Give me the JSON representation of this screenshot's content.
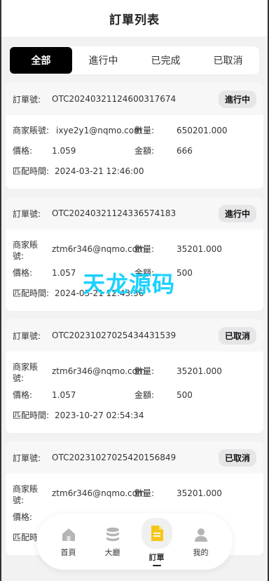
{
  "header": {
    "title": "訂單列表"
  },
  "tabs": [
    {
      "label": "全部",
      "active": true
    },
    {
      "label": "進行中",
      "active": false
    },
    {
      "label": "已完成",
      "active": false
    },
    {
      "label": "已取消",
      "active": false
    }
  ],
  "labels": {
    "order_no": "訂單號:",
    "merchant": "商家賬號:",
    "merchant_wrap_1": "商家賬",
    "merchant_wrap_2": "號:",
    "price": "價格:",
    "quantity": "數量:",
    "amount": "金額:",
    "match_time": "匹配時間:"
  },
  "orders": [
    {
      "order_no": "OTC20240321124600317674",
      "status": "進行中",
      "merchant": "ixye2y1@nqmo.com",
      "quantity": "650201.000",
      "price": "1.059",
      "amount": "666",
      "match_time": "2024-03-21 12:46:00"
    },
    {
      "order_no": "OTC20240321124336574183",
      "status": "進行中",
      "merchant": "ztm6r346@nqmo.com",
      "quantity": "35201.000",
      "price": "1.057",
      "amount": "500",
      "match_time": "2024-03-21 12:43:36"
    },
    {
      "order_no": "OTC20231027025434431539",
      "status": "已取消",
      "merchant": "ztm6r346@nqmo.com",
      "quantity": "35201.000",
      "price": "1.057",
      "amount": "500",
      "match_time": "2023-10-27 02:54:34"
    },
    {
      "order_no": "OTC20231027025420156849",
      "status": "已取消",
      "merchant": "ztm6r346@nqmo.com",
      "quantity": "35201.000",
      "price": "",
      "amount": "",
      "match_time": ""
    }
  ],
  "watermark": "天龙源码",
  "bottom_nav": [
    {
      "label": "首頁",
      "icon": "home-icon",
      "active": false
    },
    {
      "label": "大廳",
      "icon": "database-icon",
      "active": false
    },
    {
      "label": "訂單",
      "icon": "document-icon",
      "active": true
    },
    {
      "label": "我的",
      "icon": "user-icon",
      "active": false
    }
  ],
  "colors": {
    "accent": "#000000",
    "active_icon": "#f5c518",
    "watermark": "#1ad1ff",
    "badge_bg": "#e6e6e8"
  }
}
